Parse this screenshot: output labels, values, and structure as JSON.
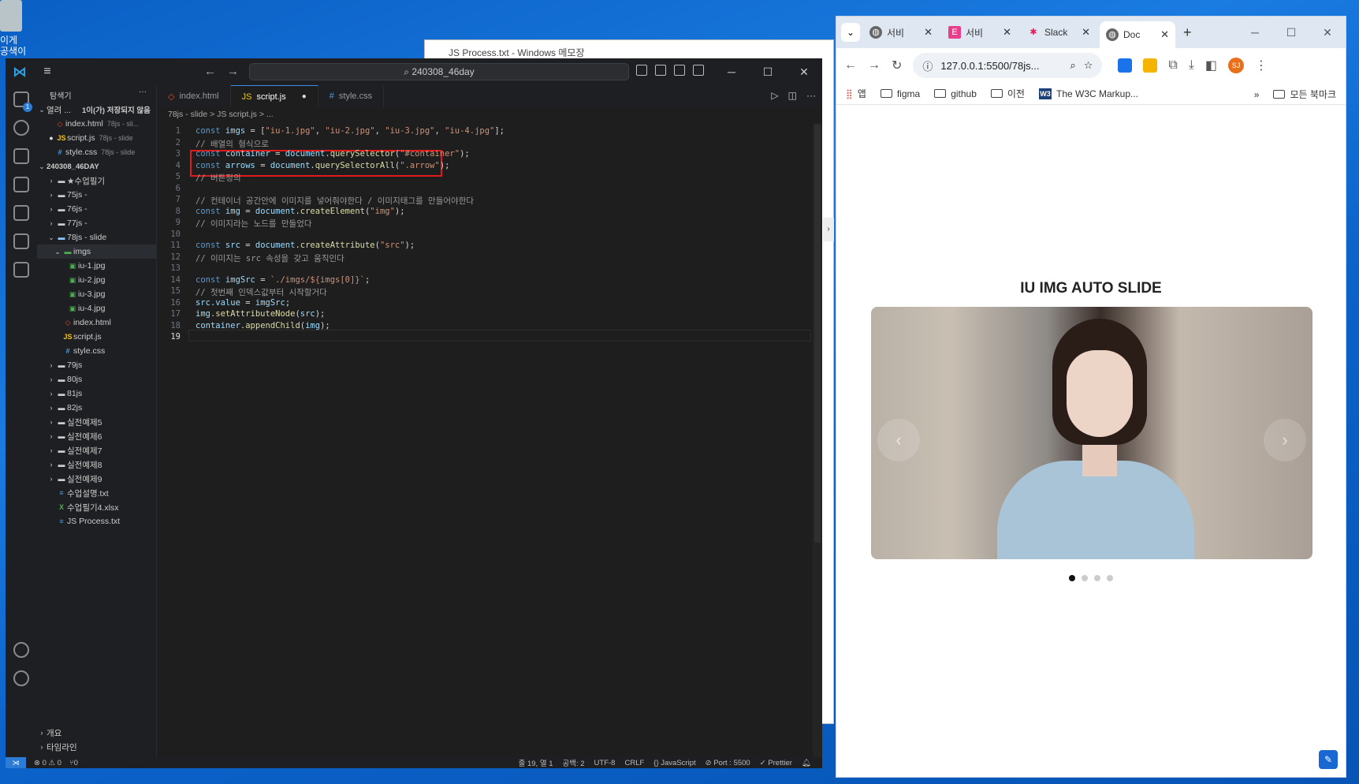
{
  "desktop": {
    "icon_label": "이게\n공색이"
  },
  "notepad": {
    "title": "JS Process.txt - Windows 메모장"
  },
  "vscode": {
    "search": "240308_46day",
    "explorer_title": "탐색기",
    "open_editors_label": "열려 ...",
    "unsaved_label": "1이(가) 저장되지 않음",
    "open_editors": [
      {
        "name": "index.html",
        "hint": "78js - sli..."
      },
      {
        "name": "script.js",
        "hint": "78js - slide"
      },
      {
        "name": "style.css",
        "hint": "78js - slide"
      }
    ],
    "workspace": "240308_46DAY",
    "tree": [
      {
        "label": "★수업필기"
      },
      {
        "label": "75js -"
      },
      {
        "label": "76js -"
      },
      {
        "label": "77js -"
      },
      {
        "label": "78js - slide"
      },
      {
        "label": "imgs"
      },
      {
        "label": "iu-1.jpg"
      },
      {
        "label": "iu-2.jpg"
      },
      {
        "label": "iu-3.jpg"
      },
      {
        "label": "iu-4.jpg"
      },
      {
        "label": "index.html"
      },
      {
        "label": "script.js"
      },
      {
        "label": "style.css"
      },
      {
        "label": "79js"
      },
      {
        "label": "80js"
      },
      {
        "label": "81js"
      },
      {
        "label": "82js"
      },
      {
        "label": "실전예제5"
      },
      {
        "label": "실전예제6"
      },
      {
        "label": "실전예제7"
      },
      {
        "label": "실전예제8"
      },
      {
        "label": "실전예제9"
      },
      {
        "label": "수업설명.txt"
      },
      {
        "label": "수업필기4.xlsx"
      },
      {
        "label": "JS Process.txt"
      }
    ],
    "outline_label": "개요",
    "timeline_label": "타임라인",
    "tabs": [
      {
        "label": "index.html"
      },
      {
        "label": "script.js"
      },
      {
        "label": "style.css"
      }
    ],
    "breadcrumb": "78js - slide  >  JS script.js  >  ...",
    "status": {
      "errors": "⊗ 0 ⚠ 0",
      "ports": "⑂0",
      "position": "줄 19, 열 1",
      "spaces": "공백: 2",
      "encoding": "UTF-8",
      "eol": "CRLF",
      "language": "{} JavaScript",
      "port": "⊘ Port : 5500",
      "prettier": "✓ Prettier"
    },
    "badge_count": "1"
  },
  "code_lines": [
    {
      "n": "1"
    },
    {
      "n": "2"
    },
    {
      "n": "3"
    },
    {
      "n": "4"
    },
    {
      "n": "5"
    },
    {
      "n": "6"
    },
    {
      "n": "7"
    },
    {
      "n": "8"
    },
    {
      "n": "9"
    },
    {
      "n": "10"
    },
    {
      "n": "11"
    },
    {
      "n": "12"
    },
    {
      "n": "13"
    },
    {
      "n": "14"
    },
    {
      "n": "15"
    },
    {
      "n": "16"
    },
    {
      "n": "17"
    },
    {
      "n": "18"
    },
    {
      "n": "19"
    }
  ],
  "code": {
    "l1_kw": "const",
    "l1_var": " imgs",
    "l1_rest": " = [",
    "l1_s1": "\"iu-1.jpg\"",
    "l1_s2": "\"iu-2.jpg\"",
    "l1_s3": "\"iu-3.jpg\"",
    "l1_s4": "\"iu-4.jpg\"",
    "l1_end": "];",
    "l2": "// 배열의 형식으로",
    "l3_kw": "const",
    "l3_var": " container",
    "l3_eq": " = ",
    "l3_obj": "document",
    "l3_fn": "querySelector",
    "l3_str": "\"#container\"",
    "l3_end": ");",
    "l4_kw": "const",
    "l4_var": " arrows",
    "l4_eq": " = ",
    "l4_obj": "document",
    "l4_fn": "querySelectorAll",
    "l4_str": "\".arrow\"",
    "l4_end": ");",
    "l5": "// 버튼정의",
    "l7": "// 컨테이너 공간안에 이미지를 넣어줘야한다 / 이미지태그를 만들어야한다",
    "l8_kw": "const",
    "l8_var": " img",
    "l8_eq": " = ",
    "l8_obj": "document",
    "l8_fn": "createElement",
    "l8_str": "\"img\"",
    "l8_end": ");",
    "l9": "// 이미지라는 노드를 만들었다",
    "l11_kw": "const",
    "l11_var": " src",
    "l11_eq": " = ",
    "l11_obj": "document",
    "l11_fn": "createAttribute",
    "l11_str": "\"src\"",
    "l11_end": ");",
    "l12": "// 이미지는 src 속성을 갖고 움직인다",
    "l14_kw": "const",
    "l14_var": " imgSrc",
    "l14_eq": " = ",
    "l14_str": "`./imgs/${imgs[0]}`",
    "l14_end": ";",
    "l15": "// 첫번째 인덱스값부터 시작할거다",
    "l16_var": "src",
    "l16_prop": ".value",
    "l16_eq": " = ",
    "l16_v": "imgSrc",
    "l16_end": ";",
    "l17_var": "img",
    "l17_fn": ".setAttributeNode",
    "l17_arg": "src",
    "l17_end": ");",
    "l18_var": "container",
    "l18_fn": ".appendChild",
    "l18_arg": "img",
    "l18_end": ");"
  },
  "chrome": {
    "tabs": [
      {
        "label": "서비"
      },
      {
        "label": "서비"
      },
      {
        "label": "Slack"
      },
      {
        "label": "Doc"
      }
    ],
    "url": "127.0.0.1:5500/78js...",
    "bookmarks": [
      {
        "label": "앱"
      },
      {
        "label": "figma"
      },
      {
        "label": "github"
      },
      {
        "label": "이전"
      },
      {
        "label": "The W3C Markup..."
      }
    ],
    "all_bookmarks": "모든 북마크",
    "avatar": "SJ",
    "more_bookmarks": "»"
  },
  "webpage": {
    "title": "IU IMG AUTO SLIDE",
    "prev_arrow": "‹",
    "next_arrow": "›",
    "slide_count": 4,
    "active_slide": 1
  }
}
